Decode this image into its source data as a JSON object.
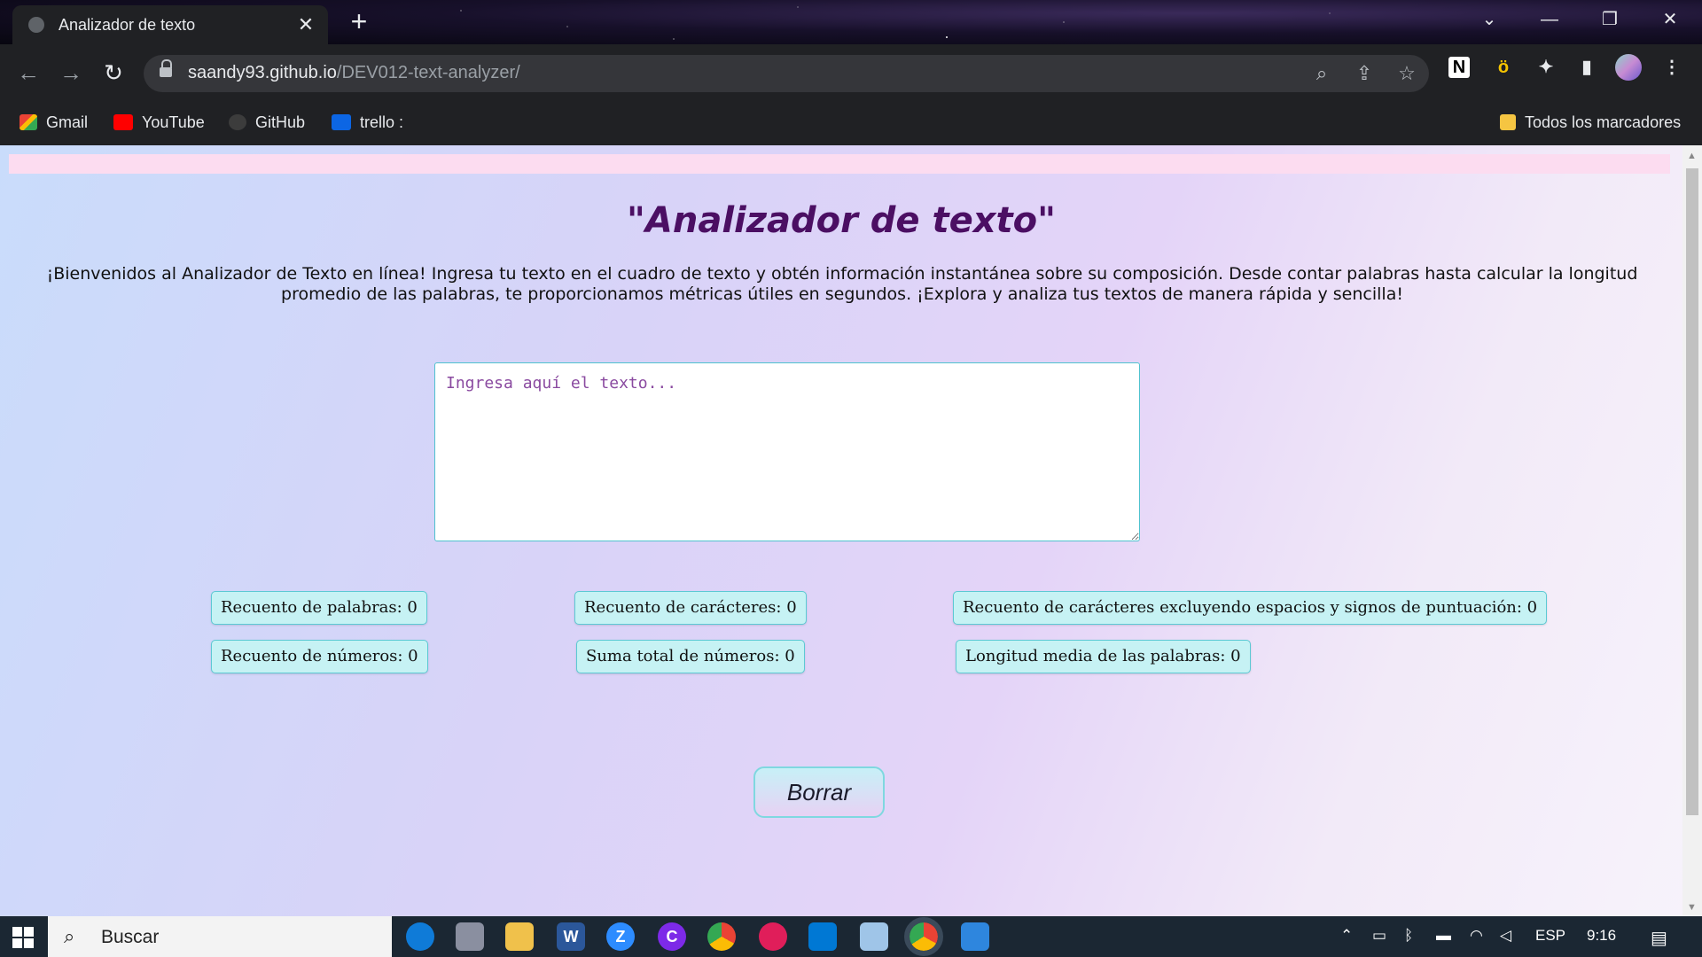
{
  "browser": {
    "tab_title": "Analizador de texto",
    "tab_close": "✕",
    "new_tab": "+",
    "window_controls": [
      "⌄",
      "—",
      "❐",
      "✕"
    ],
    "url_host": "saandy93.github.io",
    "url_path": "/DEV012-text-analyzer/",
    "nav": {
      "back": "←",
      "forward": "→",
      "reload": "↻"
    },
    "omnibox_icons": {
      "zoom": "⌕",
      "share": "⇪",
      "star": "☆"
    },
    "extensions": [
      {
        "name": "notion",
        "glyph": "N"
      },
      {
        "name": "honey",
        "glyph": "ö"
      },
      {
        "name": "puzzle",
        "glyph": "✦"
      },
      {
        "name": "sidepanel",
        "glyph": "▮"
      },
      {
        "name": "menu",
        "glyph": "⋮"
      }
    ],
    "bookmarks": [
      "Gmail",
      "YouTube",
      "GitHub",
      "trello :"
    ],
    "all_bookmarks": "Todos los marcadores"
  },
  "page": {
    "title": "\"Analizador de texto\"",
    "intro": "¡Bienvenidos al Analizador de Texto en línea! Ingresa tu texto en el cuadro de texto y obtén información instantánea sobre su composición. Desde contar palabras hasta calcular la longitud promedio de las palabras, te proporcionamos métricas útiles en segundos. ¡Explora y analiza tus textos de manera rápida y sencilla!",
    "textarea_placeholder": "Ingresa aquí el texto...",
    "stats": {
      "word_count": "Recuento de palabras: 0",
      "char_count": "Recuento de carácteres: 0",
      "char_no_spaces": "Recuento de carácteres excluyendo espacios y signos de puntuación: 0",
      "number_count": "Recuento de números: 0",
      "number_sum": "Suma total de números: 0",
      "avg_length": "Longitud media de las palabras: 0"
    },
    "clear_button": "Borrar"
  },
  "taskbar": {
    "search_placeholder": "Buscar",
    "language": "ESP",
    "time": "9:16"
  },
  "colors": {
    "title": "#4b0f63",
    "stat_bg": "#c6f2f4",
    "stat_border": "#5cc9d4",
    "pink_bar": "#fcdcf0"
  }
}
